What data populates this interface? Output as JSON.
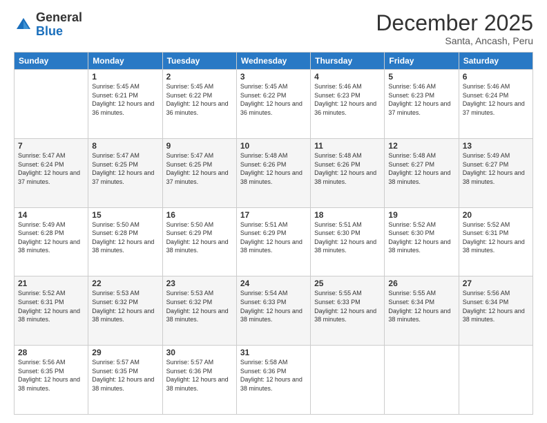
{
  "header": {
    "logo_general": "General",
    "logo_blue": "Blue",
    "month_year": "December 2025",
    "location": "Santa, Ancash, Peru"
  },
  "days_of_week": [
    "Sunday",
    "Monday",
    "Tuesday",
    "Wednesday",
    "Thursday",
    "Friday",
    "Saturday"
  ],
  "weeks": [
    [
      {
        "day": "",
        "info": ""
      },
      {
        "day": "1",
        "info": "Sunrise: 5:45 AM\nSunset: 6:21 PM\nDaylight: 12 hours and 36 minutes."
      },
      {
        "day": "2",
        "info": "Sunrise: 5:45 AM\nSunset: 6:22 PM\nDaylight: 12 hours and 36 minutes."
      },
      {
        "day": "3",
        "info": "Sunrise: 5:45 AM\nSunset: 6:22 PM\nDaylight: 12 hours and 36 minutes."
      },
      {
        "day": "4",
        "info": "Sunrise: 5:46 AM\nSunset: 6:23 PM\nDaylight: 12 hours and 36 minutes."
      },
      {
        "day": "5",
        "info": "Sunrise: 5:46 AM\nSunset: 6:23 PM\nDaylight: 12 hours and 37 minutes."
      },
      {
        "day": "6",
        "info": "Sunrise: 5:46 AM\nSunset: 6:24 PM\nDaylight: 12 hours and 37 minutes."
      }
    ],
    [
      {
        "day": "7",
        "info": "Sunrise: 5:47 AM\nSunset: 6:24 PM\nDaylight: 12 hours and 37 minutes."
      },
      {
        "day": "8",
        "info": "Sunrise: 5:47 AM\nSunset: 6:25 PM\nDaylight: 12 hours and 37 minutes."
      },
      {
        "day": "9",
        "info": "Sunrise: 5:47 AM\nSunset: 6:25 PM\nDaylight: 12 hours and 37 minutes."
      },
      {
        "day": "10",
        "info": "Sunrise: 5:48 AM\nSunset: 6:26 PM\nDaylight: 12 hours and 38 minutes."
      },
      {
        "day": "11",
        "info": "Sunrise: 5:48 AM\nSunset: 6:26 PM\nDaylight: 12 hours and 38 minutes."
      },
      {
        "day": "12",
        "info": "Sunrise: 5:48 AM\nSunset: 6:27 PM\nDaylight: 12 hours and 38 minutes."
      },
      {
        "day": "13",
        "info": "Sunrise: 5:49 AM\nSunset: 6:27 PM\nDaylight: 12 hours and 38 minutes."
      }
    ],
    [
      {
        "day": "14",
        "info": "Sunrise: 5:49 AM\nSunset: 6:28 PM\nDaylight: 12 hours and 38 minutes."
      },
      {
        "day": "15",
        "info": "Sunrise: 5:50 AM\nSunset: 6:28 PM\nDaylight: 12 hours and 38 minutes."
      },
      {
        "day": "16",
        "info": "Sunrise: 5:50 AM\nSunset: 6:29 PM\nDaylight: 12 hours and 38 minutes."
      },
      {
        "day": "17",
        "info": "Sunrise: 5:51 AM\nSunset: 6:29 PM\nDaylight: 12 hours and 38 minutes."
      },
      {
        "day": "18",
        "info": "Sunrise: 5:51 AM\nSunset: 6:30 PM\nDaylight: 12 hours and 38 minutes."
      },
      {
        "day": "19",
        "info": "Sunrise: 5:52 AM\nSunset: 6:30 PM\nDaylight: 12 hours and 38 minutes."
      },
      {
        "day": "20",
        "info": "Sunrise: 5:52 AM\nSunset: 6:31 PM\nDaylight: 12 hours and 38 minutes."
      }
    ],
    [
      {
        "day": "21",
        "info": "Sunrise: 5:52 AM\nSunset: 6:31 PM\nDaylight: 12 hours and 38 minutes."
      },
      {
        "day": "22",
        "info": "Sunrise: 5:53 AM\nSunset: 6:32 PM\nDaylight: 12 hours and 38 minutes."
      },
      {
        "day": "23",
        "info": "Sunrise: 5:53 AM\nSunset: 6:32 PM\nDaylight: 12 hours and 38 minutes."
      },
      {
        "day": "24",
        "info": "Sunrise: 5:54 AM\nSunset: 6:33 PM\nDaylight: 12 hours and 38 minutes."
      },
      {
        "day": "25",
        "info": "Sunrise: 5:55 AM\nSunset: 6:33 PM\nDaylight: 12 hours and 38 minutes."
      },
      {
        "day": "26",
        "info": "Sunrise: 5:55 AM\nSunset: 6:34 PM\nDaylight: 12 hours and 38 minutes."
      },
      {
        "day": "27",
        "info": "Sunrise: 5:56 AM\nSunset: 6:34 PM\nDaylight: 12 hours and 38 minutes."
      }
    ],
    [
      {
        "day": "28",
        "info": "Sunrise: 5:56 AM\nSunset: 6:35 PM\nDaylight: 12 hours and 38 minutes."
      },
      {
        "day": "29",
        "info": "Sunrise: 5:57 AM\nSunset: 6:35 PM\nDaylight: 12 hours and 38 minutes."
      },
      {
        "day": "30",
        "info": "Sunrise: 5:57 AM\nSunset: 6:36 PM\nDaylight: 12 hours and 38 minutes."
      },
      {
        "day": "31",
        "info": "Sunrise: 5:58 AM\nSunset: 6:36 PM\nDaylight: 12 hours and 38 minutes."
      },
      {
        "day": "",
        "info": ""
      },
      {
        "day": "",
        "info": ""
      },
      {
        "day": "",
        "info": ""
      }
    ]
  ]
}
